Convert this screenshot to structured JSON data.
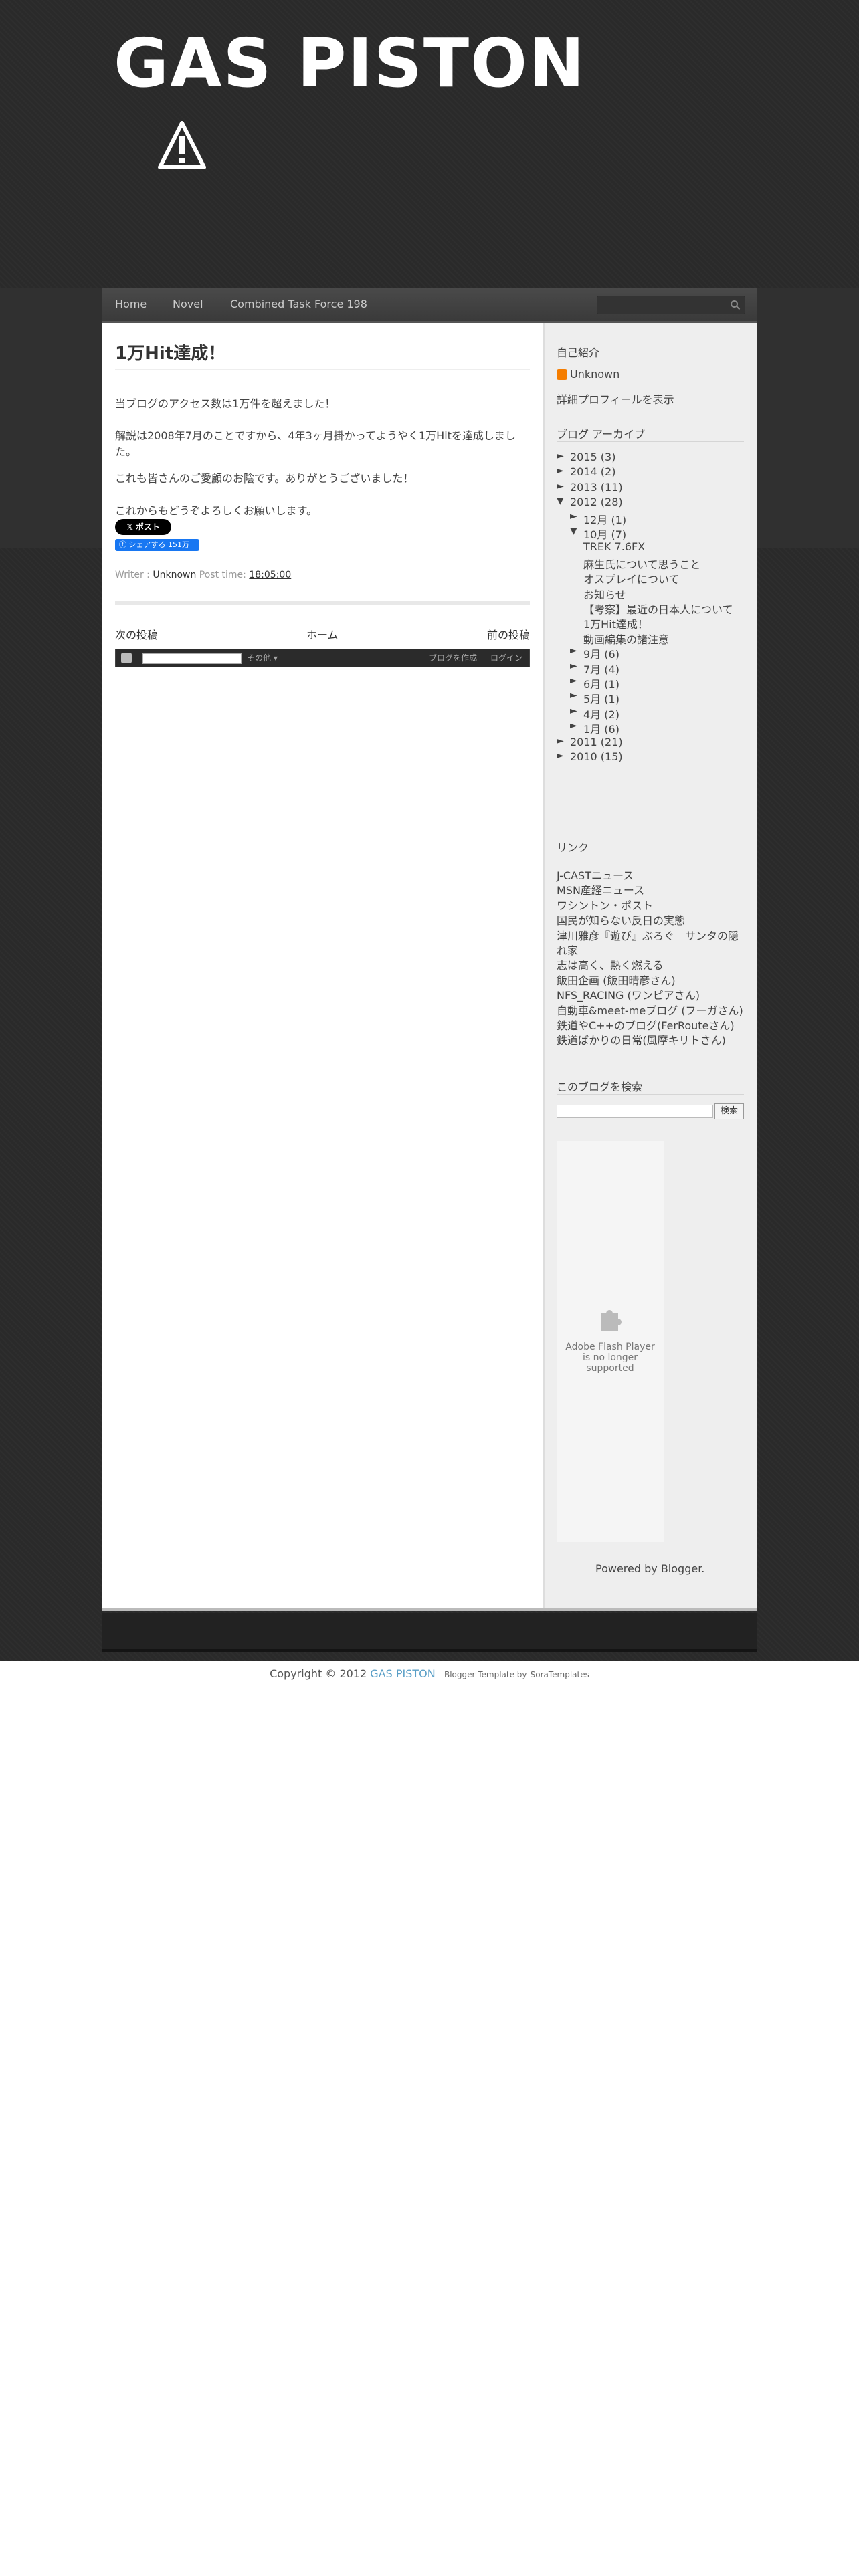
{
  "header": {
    "site_title": "GAS PISTON"
  },
  "nav": {
    "items": [
      {
        "label": "Home"
      },
      {
        "label": "Novel"
      },
      {
        "label": "Combined Task Force 198"
      }
    ]
  },
  "post": {
    "title": "1万Hit達成！",
    "paragraphs": [
      "当ブログのアクセス数は1万件を超えました！",
      "解説は2008年7月のことですから、4年3ヶ月掛かってようやく1万Hitを達成しました。",
      "これも皆さんのご愛顧のお陰です。ありがとうございました！",
      "これからもどうぞよろしくお願いします。"
    ],
    "x_button": "ポスト",
    "fb_button": "シェアする 151万",
    "meta": {
      "writer_label": "Writer :",
      "writer": "Unknown",
      "time_label": "Post time:",
      "time": "18:05:00"
    },
    "pager": {
      "newer": "次の投稿",
      "home": "ホーム",
      "older": "前の投稿"
    }
  },
  "blogger_bar": {
    "more": "その他 ▾",
    "create": "ブログを作成",
    "login": "ログイン"
  },
  "sidebar": {
    "profile": {
      "heading": "自己紹介",
      "name": "Unknown",
      "link": "詳細プロフィールを表示"
    },
    "archive": {
      "heading": "ブログ アーカイブ",
      "rows": [
        {
          "arrow": "►",
          "text": "2015 (3)",
          "level": 0
        },
        {
          "arrow": "►",
          "text": "2014 (2)",
          "level": 0
        },
        {
          "arrow": "►",
          "text": "2013 (11)",
          "level": 0
        },
        {
          "arrow": "▼",
          "text": "2012 (28)",
          "level": 0
        },
        {
          "arrow": "►",
          "text": "12月 (1)",
          "level": 1
        },
        {
          "arrow": "▼",
          "text": "10月 (7)",
          "level": 1
        },
        {
          "arrow": "",
          "text": "TREK 7.6FX",
          "level": 2
        },
        {
          "arrow": "",
          "text": "麻生氏について思うこと",
          "level": 2
        },
        {
          "arrow": "",
          "text": "オスプレイについて",
          "level": 2
        },
        {
          "arrow": "",
          "text": "お知らせ",
          "level": 2
        },
        {
          "arrow": "",
          "text": "【考察】最近の日本人について",
          "level": 2
        },
        {
          "arrow": "",
          "text": "1万Hit達成！",
          "level": 2
        },
        {
          "arrow": "",
          "text": "動画編集の諸注意",
          "level": 2
        },
        {
          "arrow": "►",
          "text": "9月 (6)",
          "level": 1
        },
        {
          "arrow": "►",
          "text": "7月 (4)",
          "level": 1
        },
        {
          "arrow": "►",
          "text": "6月 (1)",
          "level": 1
        },
        {
          "arrow": "►",
          "text": "5月 (1)",
          "level": 1
        },
        {
          "arrow": "►",
          "text": "4月 (2)",
          "level": 1
        },
        {
          "arrow": "►",
          "text": "1月 (6)",
          "level": 1
        },
        {
          "arrow": "►",
          "text": "2011 (21)",
          "level": 0
        },
        {
          "arrow": "►",
          "text": "2010 (15)",
          "level": 0
        }
      ]
    },
    "links": {
      "heading": "リンク",
      "items": [
        "J-CASTニュース",
        "MSN産経ニュース",
        "ワシントン・ポスト",
        "国民が知らない反日の実態",
        "津川雅彦『遊び』ぶろぐ　サンタの隠",
        "れ家",
        "志は高く、熱く燃える",
        "飯田企画 (飯田晴彦さん)",
        "NFS_RACING (ワンピアさん)",
        "自動車&meet-meブログ (フーガさん)",
        "鉄道やC++のブログ(FerRouteさん)",
        "鉄道ばかりの日常(風摩キリトさん)"
      ]
    },
    "search": {
      "heading": "このブログを検索",
      "button": "検索"
    },
    "flash": {
      "text": "Adobe Flash Player is no longer supported"
    },
    "powered": "Powered by Blogger."
  },
  "footer": {
    "copyright_prefix": "Copyright © 2012",
    "site": "GAS PISTON",
    "template_text": "- Blogger Template by",
    "template_link": "SoraTemplates"
  }
}
